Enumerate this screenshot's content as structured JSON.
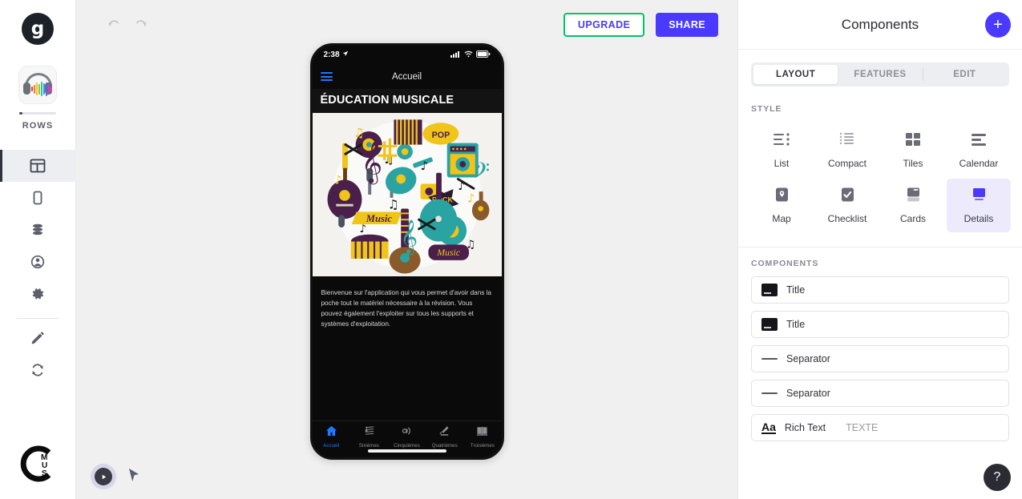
{
  "rail": {
    "brand": "g",
    "app_name": "ROWS",
    "app_icon": "headphones-waveform-icon",
    "nav": [
      {
        "id": "layout",
        "icon": "layout-icon",
        "active": true
      },
      {
        "id": "screens",
        "icon": "mobile-icon",
        "active": false
      },
      {
        "id": "data",
        "icon": "database-icon",
        "active": false
      },
      {
        "id": "users",
        "icon": "user-icon",
        "active": false
      },
      {
        "id": "settings",
        "icon": "gear-icon",
        "active": false
      },
      {
        "id": "edit",
        "icon": "pencil-icon",
        "active": false
      },
      {
        "id": "sync",
        "icon": "refresh-icon",
        "active": false
      }
    ],
    "footer_logo": "cmus-logo",
    "footer_logo_letters": [
      "M",
      "U",
      "S"
    ]
  },
  "toolbar": {
    "undo": "undo-icon",
    "redo": "redo-icon",
    "upgrade_label": "UPGRADE",
    "share_label": "SHARE",
    "upgrade_border_color": "#00c46a",
    "accent_blue": "#4a3aff"
  },
  "phone": {
    "status": {
      "time": "2:38",
      "location_arrow": "location-arrow-icon"
    },
    "nav_title": "Accueil",
    "menu_icon": "hamburger-menu-icon",
    "page_heading": "ÉDUCATION MUSICALE",
    "hero_image": "music-instruments-collage",
    "body_text": "Bienvenue sur l'application qui vous permet d'avoir dans la poche tout le matériel nécessaire à la révision. Vous pouvez également l'exploiter sur tous les supports et systèmes d'exploitation.",
    "tabs": [
      {
        "label": "Accueil",
        "icon": "home-icon",
        "active": true
      },
      {
        "label": "Sixièmes",
        "icon": "sheet-music-icon",
        "active": false
      },
      {
        "label": "Cinquièmes",
        "icon": "sound-wave-icon",
        "active": false
      },
      {
        "label": "Quatrièmes",
        "icon": "conductor-icon",
        "active": false
      },
      {
        "label": "Troisièmes",
        "icon": "book-icon",
        "active": false
      }
    ],
    "active_tab_color": "#1f78ff"
  },
  "canvas": {
    "play_button": "play-preview-button",
    "cursor_tool": "pointer-cursor-icon"
  },
  "panel": {
    "title": "Components",
    "add_button": "+",
    "tabs": [
      {
        "label": "LAYOUT",
        "active": true
      },
      {
        "label": "FEATURES",
        "active": false
      },
      {
        "label": "EDIT",
        "active": false
      }
    ],
    "style_label": "STYLE",
    "styles": [
      {
        "label": "List",
        "icon": "list-icon",
        "selected": false
      },
      {
        "label": "Compact",
        "icon": "compact-icon",
        "selected": false
      },
      {
        "label": "Tiles",
        "icon": "tiles-icon",
        "selected": false
      },
      {
        "label": "Calendar",
        "icon": "calendar-icon",
        "selected": false
      },
      {
        "label": "Map",
        "icon": "map-pin-icon",
        "selected": false
      },
      {
        "label": "Checklist",
        "icon": "checklist-icon",
        "selected": false
      },
      {
        "label": "Cards",
        "icon": "cards-icon",
        "selected": false
      },
      {
        "label": "Details",
        "icon": "details-icon",
        "selected": true
      }
    ],
    "selected_style_bg": "#eceafb",
    "components_label": "COMPONENTS",
    "components": [
      {
        "label": "Title",
        "icon": "title-icon",
        "value": ""
      },
      {
        "label": "Title",
        "icon": "title-icon",
        "value": ""
      },
      {
        "label": "Separator",
        "icon": "separator-icon",
        "value": ""
      },
      {
        "label": "Separator",
        "icon": "separator-icon",
        "value": ""
      },
      {
        "label": "Rich Text",
        "icon": "rich-text-icon",
        "value": "TEXTE"
      }
    ],
    "help_label": "?"
  }
}
